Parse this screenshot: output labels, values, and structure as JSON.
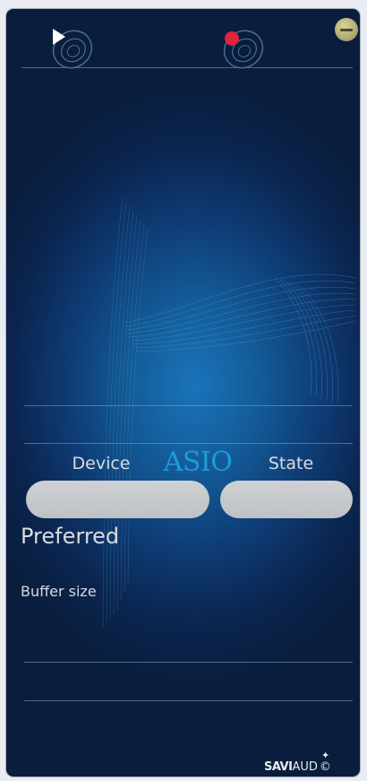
{
  "controls": {
    "play_icon": "play-icon",
    "record_icon": "record-icon",
    "minimize_icon": "minimize-icon",
    "record_color": "#e0243c",
    "minimize_color": "#b6b07a"
  },
  "asio": {
    "title": "ASIO",
    "device_label": "Device",
    "state_label": "State",
    "device_value": "",
    "state_value": ""
  },
  "settings": {
    "preferred_label": "Preferred",
    "buffer_size_label": "Buffer size"
  },
  "branding": {
    "savi": "SAVI",
    "aud": "AUD",
    "copyright": "©"
  },
  "colors": {
    "accent": "#1f9bd8",
    "background_dark": "#0a1d3c",
    "background_glow": "#1a74b9"
  }
}
